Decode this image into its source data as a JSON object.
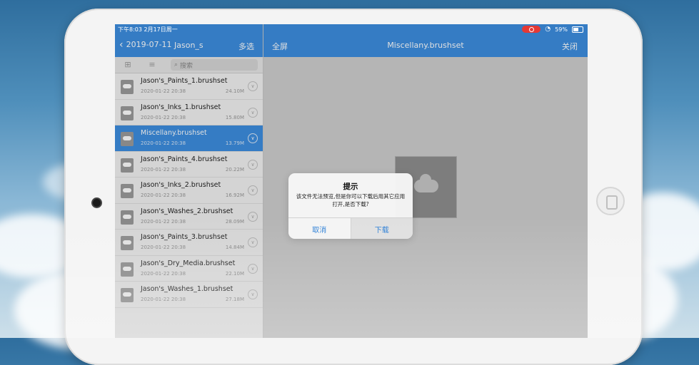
{
  "status_bar": {
    "time_date": "下午8:03  2月17日周一",
    "battery": "59%",
    "battery_level": 0.59
  },
  "left_nav": {
    "back_label": "2019-07-11",
    "user": "Jason_s",
    "multi_select": "多选"
  },
  "toolbar": {
    "new_folder_icon": "folder-plus-icon",
    "sort_icon": "sort-icon",
    "search_placeholder": "搜索"
  },
  "files": [
    {
      "name": "Jason's_Paints_1.brushset",
      "date": "2020-01-22 20:38",
      "size": "24.10M",
      "selected": false
    },
    {
      "name": "Jason's_Inks_1.brushset",
      "date": "2020-01-22 20:38",
      "size": "15.80M",
      "selected": false
    },
    {
      "name": "Miscellany.brushset",
      "date": "2020-01-22 20:38",
      "size": "13.79M",
      "selected": true
    },
    {
      "name": "Jason's_Paints_4.brushset",
      "date": "2020-01-22 20:38",
      "size": "20.22M",
      "selected": false
    },
    {
      "name": "Jason's_Inks_2.brushset",
      "date": "2020-01-22 20:38",
      "size": "16.92M",
      "selected": false
    },
    {
      "name": "Jason's_Washes_2.brushset",
      "date": "2020-01-22 20:38",
      "size": "28.09M",
      "selected": false
    },
    {
      "name": "Jason's_Paints_3.brushset",
      "date": "2020-01-22 20:38",
      "size": "14.84M",
      "selected": false
    },
    {
      "name": "Jason's_Dry_Media.brushset",
      "date": "2020-01-22 20:38",
      "size": "22.10M",
      "selected": false
    },
    {
      "name": "Jason's_Washes_1.brushset",
      "date": "2020-01-22 20:38",
      "size": "27.18M",
      "selected": false
    }
  ],
  "right_nav": {
    "fullscreen": "全屏",
    "title": "Miscellany.brushset",
    "close": "关闭"
  },
  "dialog": {
    "title": "提示",
    "message": "该文件无法预览,但是你可以下载后用其它应用打开,是否下载?",
    "cancel": "取消",
    "download": "下载"
  },
  "colors": {
    "accent": "#3d8ee0",
    "record": "#e53935",
    "dialog_button": "#2c7fd6"
  }
}
